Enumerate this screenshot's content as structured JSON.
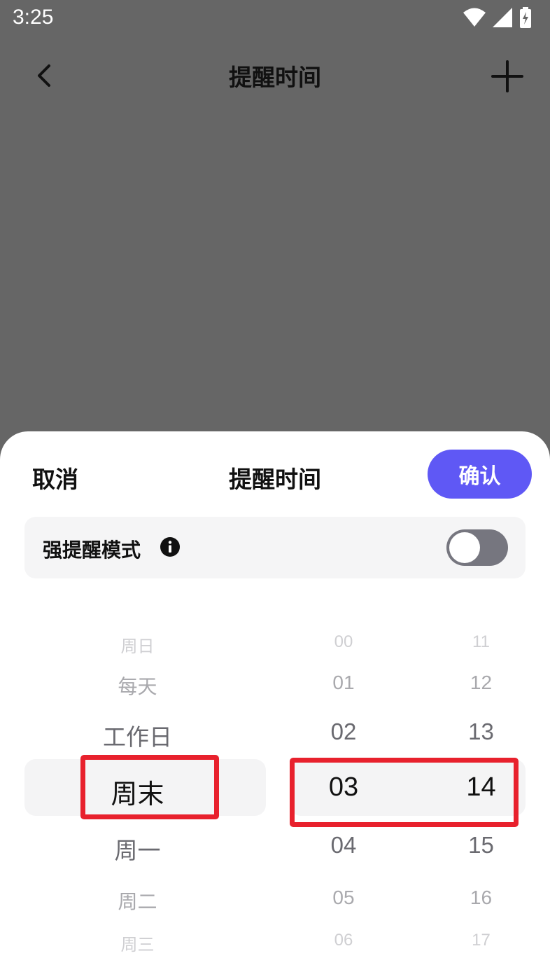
{
  "status_bar": {
    "time": "3:25",
    "icons": [
      "wifi-icon",
      "cellular-signal-icon",
      "battery-charging-icon"
    ]
  },
  "app_bar": {
    "title": "提醒时间",
    "back_icon": "chevron-left-icon",
    "add_icon": "plus-icon"
  },
  "sheet": {
    "cancel_label": "取消",
    "title": "提醒时间",
    "confirm_label": "确认",
    "strong_mode": {
      "label": "强提醒模式",
      "info_icon": "info-icon",
      "enabled": false
    },
    "picker": {
      "day": {
        "items": [
          "周日",
          "每天",
          "工作日",
          "周末",
          "周一",
          "周二",
          "周三"
        ],
        "selected": "周末"
      },
      "hour": {
        "items": [
          "00",
          "01",
          "02",
          "03",
          "04",
          "05",
          "06"
        ],
        "selected": "03"
      },
      "minute": {
        "items": [
          "11",
          "12",
          "13",
          "14",
          "15",
          "16",
          "17"
        ],
        "selected": "14"
      }
    }
  },
  "colors": {
    "overlay": "#666666",
    "sheet_bg": "#ffffff",
    "accent": "#5f58f5",
    "toggle_off": "#76767f",
    "annotation": "#e8212d"
  }
}
